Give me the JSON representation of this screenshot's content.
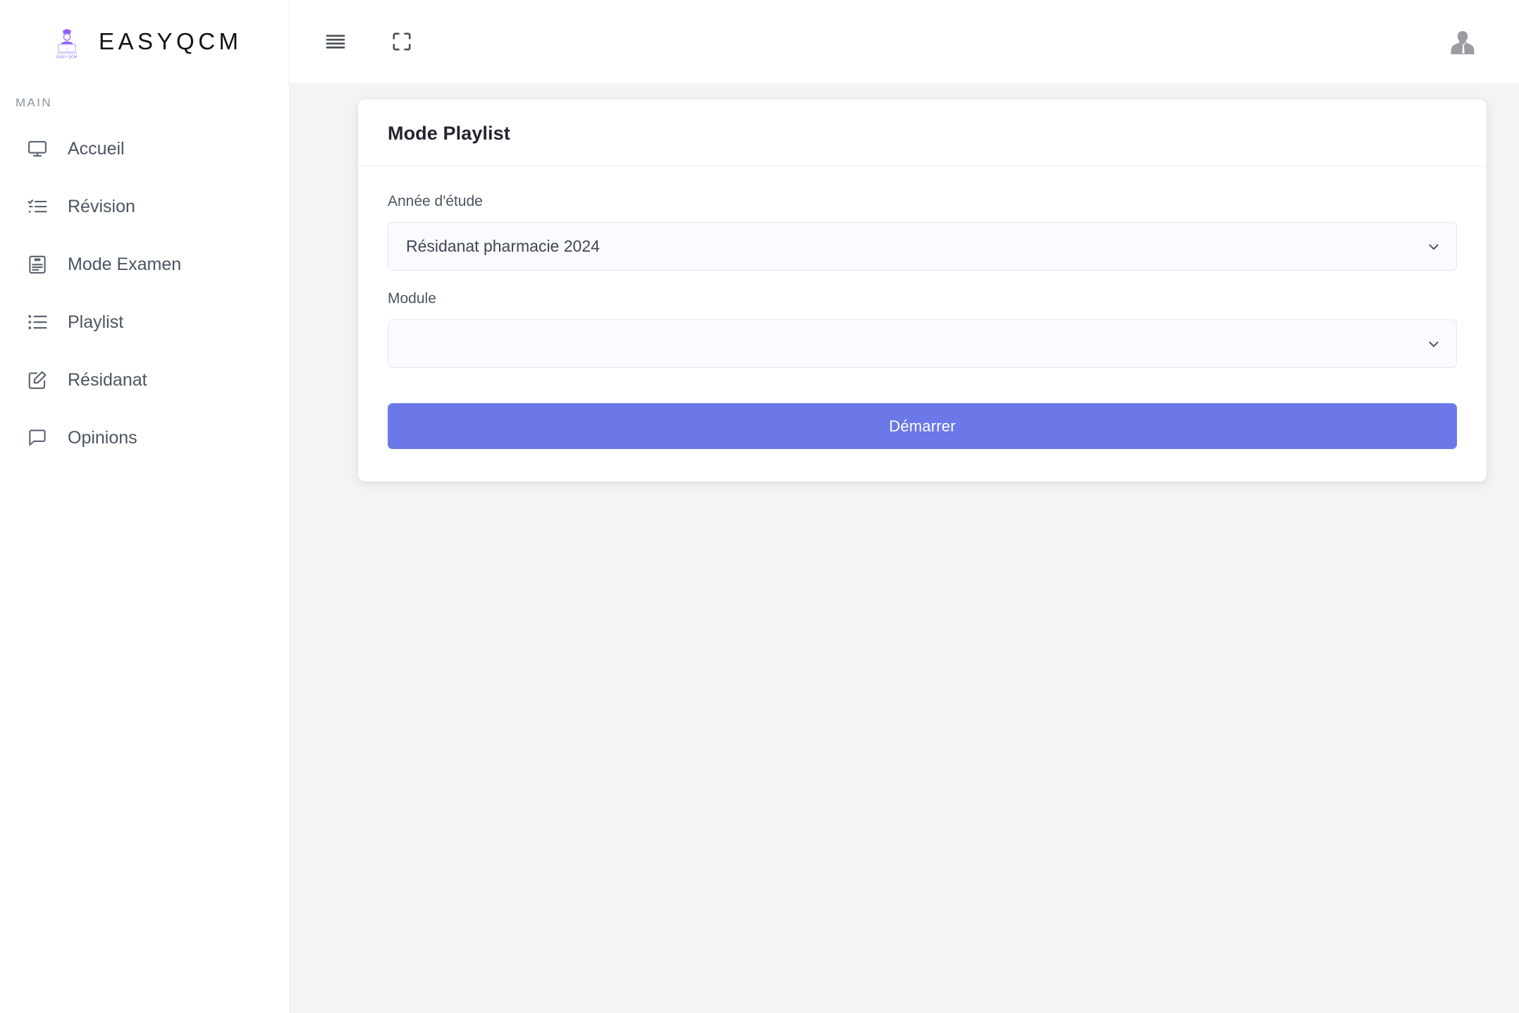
{
  "brand": {
    "name": "EASYQCM",
    "logo_icon": "graduate-laptop-logo",
    "logo_caption": "EASY QCM",
    "accent": "#8b5cf6"
  },
  "sidebar": {
    "section_label": "MAIN",
    "items": [
      {
        "label": "Accueil",
        "icon": "monitor-icon"
      },
      {
        "label": "Révision",
        "icon": "checklist-icon"
      },
      {
        "label": "Mode Examen",
        "icon": "clipboard-icon"
      },
      {
        "label": "Playlist",
        "icon": "list-icon"
      },
      {
        "label": "Résidanat",
        "icon": "edit-square-icon"
      },
      {
        "label": "Opinions",
        "icon": "chat-bubble-icon"
      }
    ]
  },
  "topbar": {
    "menu_icon": "hamburger-menu-icon",
    "fullscreen_icon": "fullscreen-icon",
    "avatar_icon": "user-avatar-placeholder"
  },
  "card": {
    "title": "Mode Playlist",
    "fields": {
      "year": {
        "label": "Année d'étude",
        "value": "Résidanat pharmacie 2024",
        "chevron_icon": "chevron-down-icon"
      },
      "module": {
        "label": "Module",
        "value": "",
        "placeholder": "",
        "chevron_icon": "chevron-down-icon"
      }
    },
    "submit_label": "Démarrer",
    "submit_color": "#6c78e8"
  }
}
